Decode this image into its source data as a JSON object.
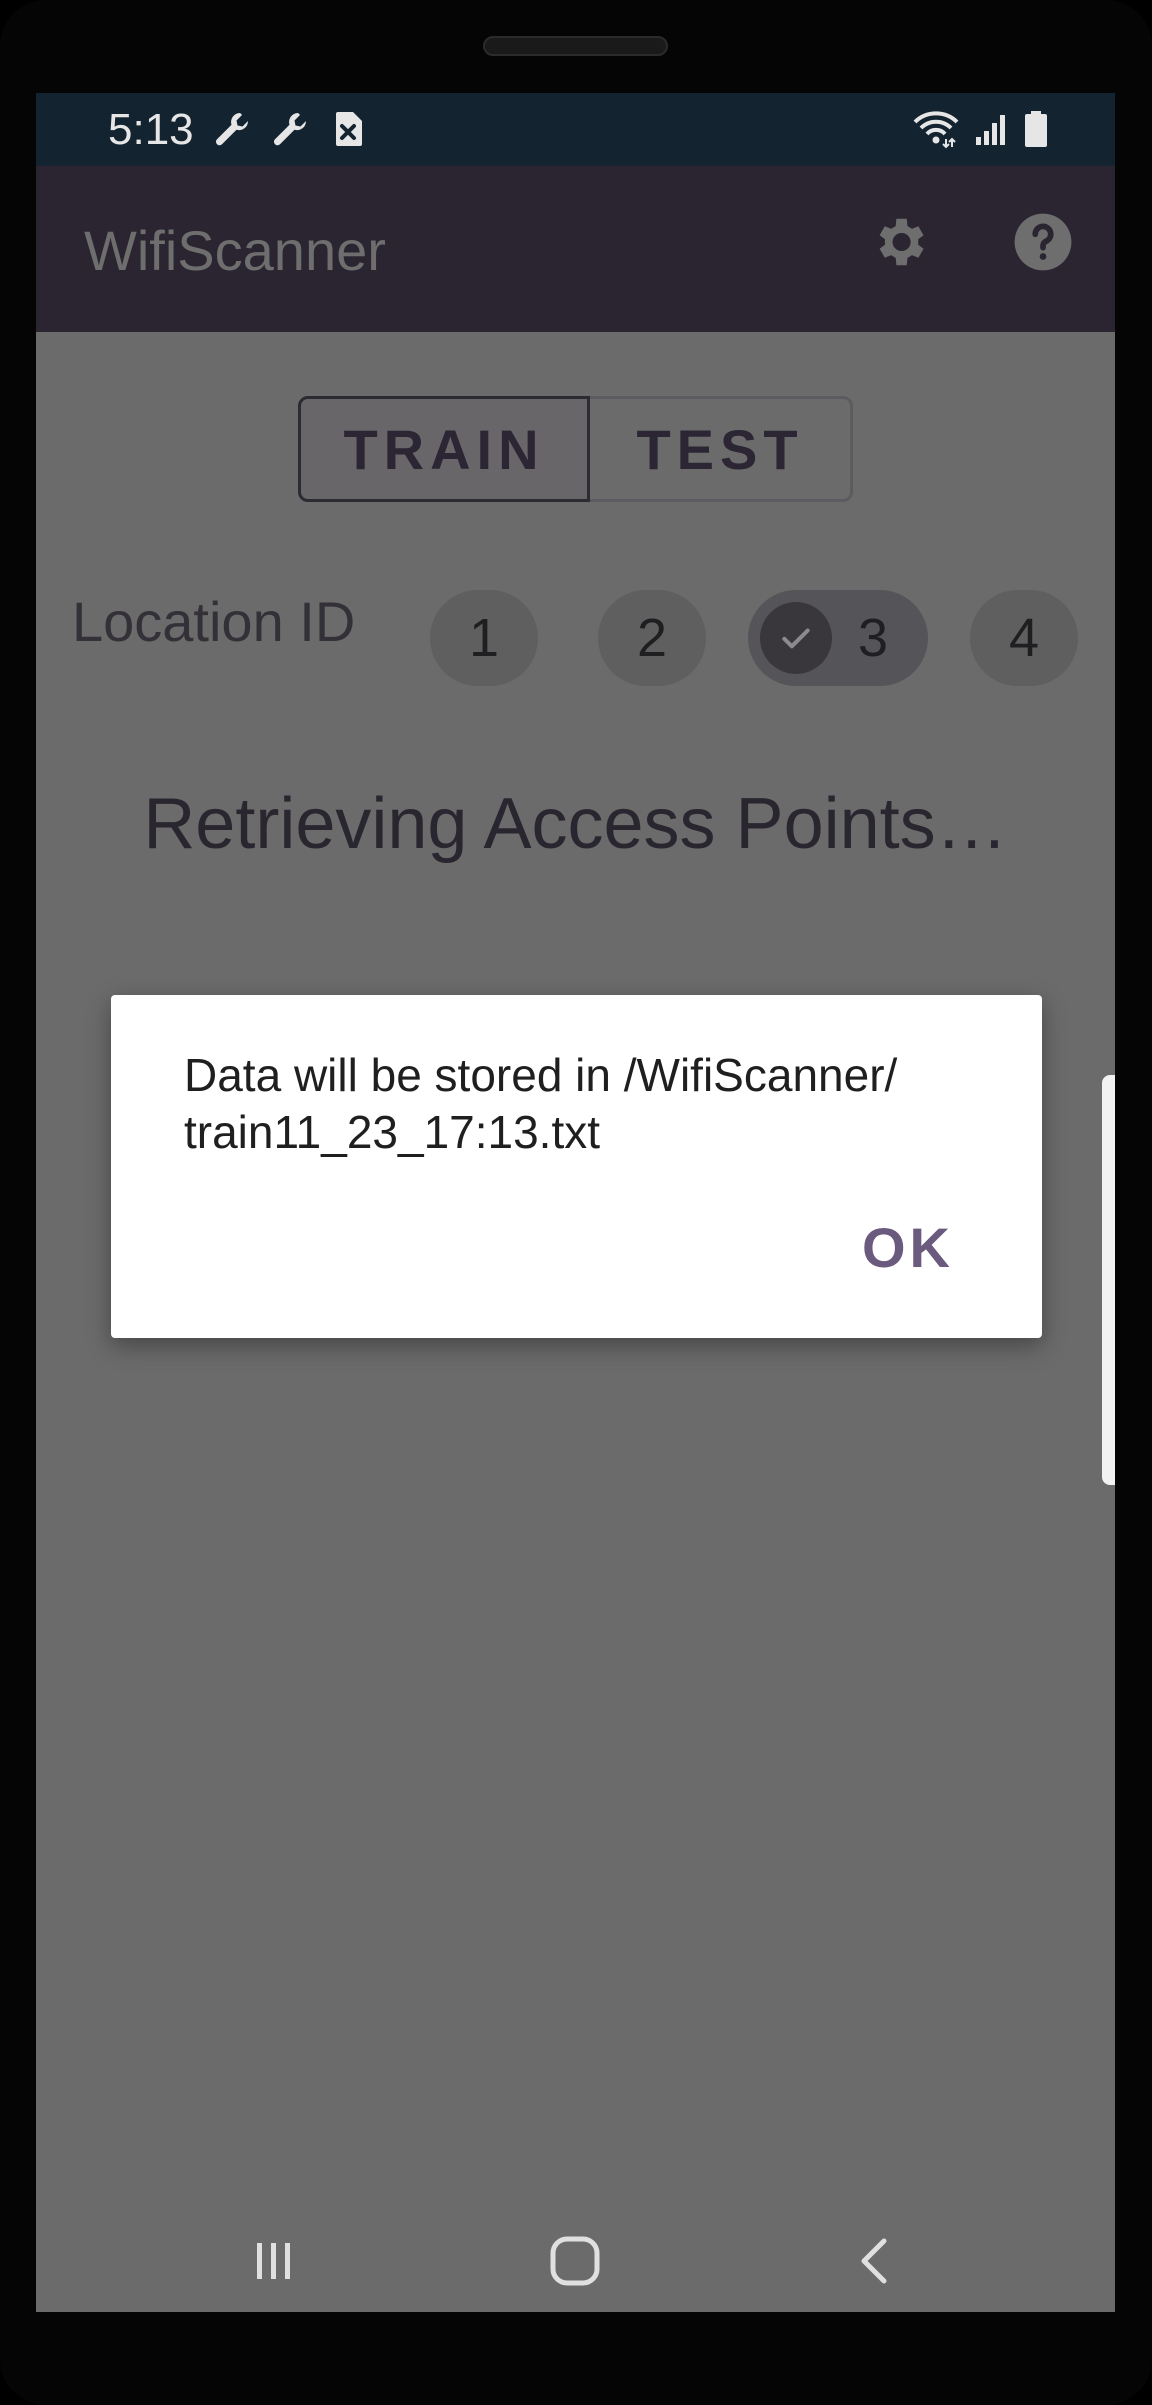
{
  "status_bar": {
    "time": "5:13",
    "icons_left": [
      "wrench-icon",
      "wrench-icon",
      "sim-blocked-icon"
    ],
    "icons_right": [
      "wifi-icon",
      "signal-icon",
      "battery-icon"
    ]
  },
  "app_bar": {
    "title": "WifiScanner",
    "actions": [
      "settings-gear-icon",
      "help-circle-icon"
    ]
  },
  "mode_toggle": {
    "options": [
      "TRAIN",
      "TEST"
    ],
    "selected": "TRAIN"
  },
  "location": {
    "label": "Location ID",
    "chips": [
      "1",
      "2",
      "3",
      "4"
    ],
    "selected": "3"
  },
  "status_message": "Retrieving Access Points…",
  "dialog": {
    "message": "Data will be stored in /WifiScanner/\ntrain11_23_17:13.txt",
    "ok_label": "OK"
  },
  "nav_bar": {
    "icons": [
      "recent-apps-icon",
      "home-icon",
      "back-icon"
    ]
  },
  "colors": {
    "status_bar_bg": "#13232f",
    "app_bar_bg": "#2a2530",
    "scrim_bg": "#6b6b6b",
    "dialog_accent": "#6a5a7d"
  }
}
